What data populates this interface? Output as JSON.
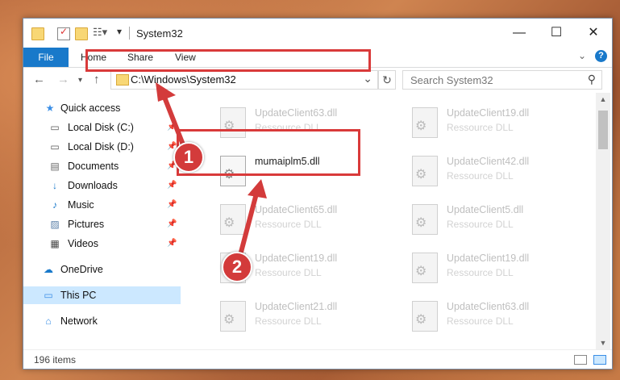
{
  "window": {
    "title": "System32",
    "controls": {
      "minimize": "—",
      "maximize": "☐",
      "close": "✕"
    }
  },
  "ribbon": {
    "tabs": [
      "File",
      "Home",
      "Share",
      "View"
    ],
    "expand_glyph": "⌄",
    "help_glyph": "?"
  },
  "address": {
    "path": "C:\\Windows\\System32",
    "refresh_glyph": "↻",
    "dropdown_glyph": "⌄"
  },
  "search": {
    "placeholder": "Search System32",
    "icon": "⚲"
  },
  "nav": {
    "items": [
      {
        "label": "Quick access",
        "icon": "★",
        "pinned": false
      },
      {
        "label": "Local Disk (C:)",
        "icon": "▭",
        "pinned": true
      },
      {
        "label": "Local Disk (D:)",
        "icon": "▭",
        "pinned": true
      },
      {
        "label": "Documents",
        "icon": "▤",
        "pinned": true
      },
      {
        "label": "Downloads",
        "icon": "↓",
        "pinned": true
      },
      {
        "label": "Music",
        "icon": "♪",
        "pinned": true
      },
      {
        "label": "Pictures",
        "icon": "▨",
        "pinned": true
      },
      {
        "label": "Videos",
        "icon": "▦",
        "pinned": true
      },
      {
        "label": "OneDrive",
        "icon": "☁",
        "pinned": false
      },
      {
        "label": "This PC",
        "icon": "▭",
        "pinned": false,
        "selected": true
      },
      {
        "label": "Network",
        "icon": "⌂",
        "pinned": false
      }
    ],
    "pin_glyph": "📌"
  },
  "files": {
    "left": [
      {
        "name": "UpdateClient63.dll",
        "type": "Ressource DLL"
      },
      {
        "name": "mumaiplm5.dll",
        "type": "",
        "focus": true
      },
      {
        "name": "UpdateClient65.dll",
        "type": "Ressource DLL"
      },
      {
        "name": "UpdateClient19.dll",
        "type": "Ressource DLL"
      },
      {
        "name": "UpdateClient21.dll",
        "type": "Ressource DLL"
      }
    ],
    "right": [
      {
        "name": "UpdateClient19.dll",
        "type": "Ressource DLL"
      },
      {
        "name": "UpdateClient42.dll",
        "type": "Ressource DLL"
      },
      {
        "name": "UpdateClient5.dll",
        "type": "Ressource DLL"
      },
      {
        "name": "UpdateClient19.dll",
        "type": "Ressource DLL"
      },
      {
        "name": "UpdateClient63.dll",
        "type": "Ressource DLL"
      }
    ]
  },
  "status": {
    "count": "196 items"
  },
  "annotations": {
    "step1": "1",
    "step2": "2",
    "color": "#d33b3b"
  }
}
